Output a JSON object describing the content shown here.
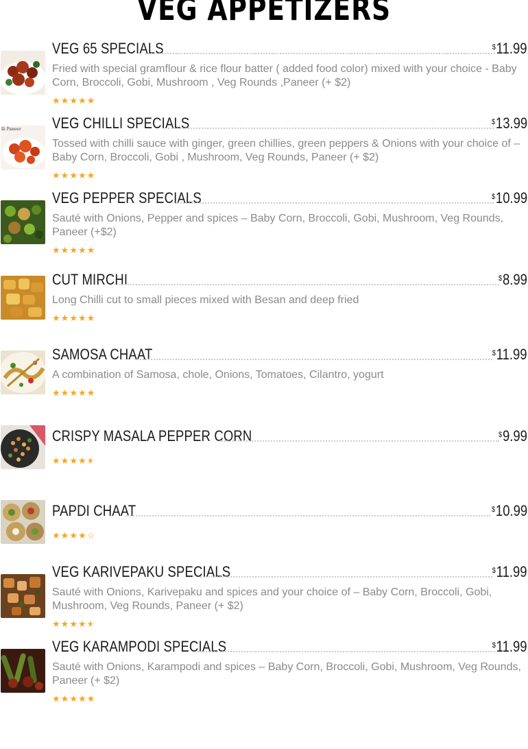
{
  "title": "VEG APPETIZERS",
  "currency": "$",
  "items": [
    {
      "name": "VEG 65 SPECIALS",
      "price": "11.99",
      "desc": "Fried with special gramflour & rice flour batter ( added food color) mixed with your choice - Baby Corn, Broccoli, Gobi, Mushroom , Veg Rounds ,Paneer (+ $2)",
      "rating": 5,
      "photo": "fried-veg-bites"
    },
    {
      "name": "VEG CHILLI SPECIALS",
      "price": "13.99",
      "desc": "Tossed with chilli sauce with ginger, green chillies, green peppers & Onions with your choice of – Baby Corn, Broccoli, Gobi , Mushroom, Veg Rounds, Paneer (+ $2)",
      "rating": 5,
      "photo": "chilli-paneer",
      "photo_text": "lli Paneer"
    },
    {
      "name": "VEG PEPPER SPECIALS",
      "price": "10.99",
      "desc": "Sauté with Onions, Pepper and spices – Baby Corn, Broccoli, Gobi, Mushroom, Veg Rounds, Paneer (+$2)",
      "rating": 5,
      "photo": "pepper-stir-fry"
    },
    {
      "name": "CUT MIRCHI",
      "price": "8.99",
      "desc": "Long Chilli cut to small pieces mixed with Besan and deep fried",
      "rating": 5,
      "photo": "cut-mirchi"
    },
    {
      "name": "SAMOSA CHAAT",
      "price": "11.99",
      "desc": "A combination of Samosa, chole, Onions, Tomatoes, Cilantro, yogurt",
      "rating": 5,
      "photo": "samosa-chaat"
    },
    {
      "name": "CRISPY MASALA PEPPER CORN",
      "price": "9.99",
      "desc": "",
      "rating": 4.5,
      "photo": "masala-corn"
    },
    {
      "name": "PAPDI CHAAT",
      "price": "10.99",
      "desc": "",
      "rating": 4,
      "photo": "papdi-chaat"
    },
    {
      "name": "VEG KARIVEPAKU SPECIALS",
      "price": "11.99",
      "desc": "Sauté with Onions, Karivepaku and spices and your choice of – Baby Corn, Broccoli, Gobi, Mushroom, Veg Rounds, Paneer (+ $2)",
      "rating": 4.5,
      "photo": "karivepaku-stir-fry"
    },
    {
      "name": "VEG KARAMPODI SPECIALS",
      "price": "11.99",
      "desc": "Sauté with Onions, Karampodi and spices – Baby Corn, Broccoli, Gobi, Mushroom, Veg Rounds, Paneer (+ $2)",
      "rating": 5,
      "photo": "karampodi-stir-fry"
    }
  ]
}
